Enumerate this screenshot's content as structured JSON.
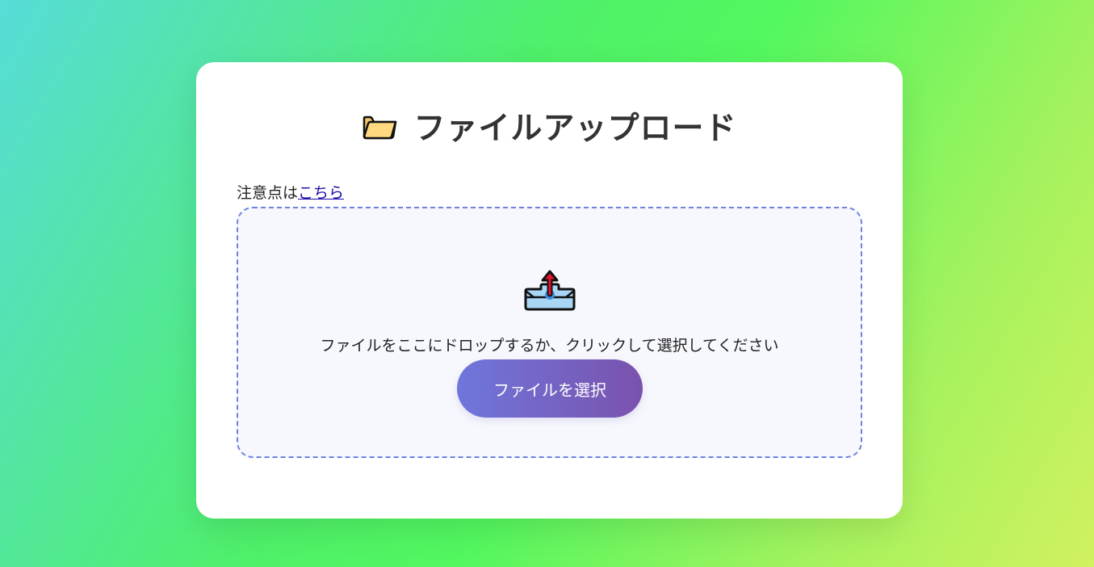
{
  "header": {
    "title": "ファイルアップロード",
    "title_icon": "folder-icon"
  },
  "notice": {
    "prefix": "注意点は",
    "link_text": "こちら"
  },
  "drop_zone": {
    "icon": "upload-tray-icon",
    "instruction": "ファイルをここにドロップするか、クリックして選択してください",
    "button_label": "ファイルを選択"
  },
  "colors": {
    "accent_start": "#6f76dc",
    "accent_end": "#7a52ad",
    "dash_border": "#6f82e0",
    "link": "#1a0dab"
  }
}
